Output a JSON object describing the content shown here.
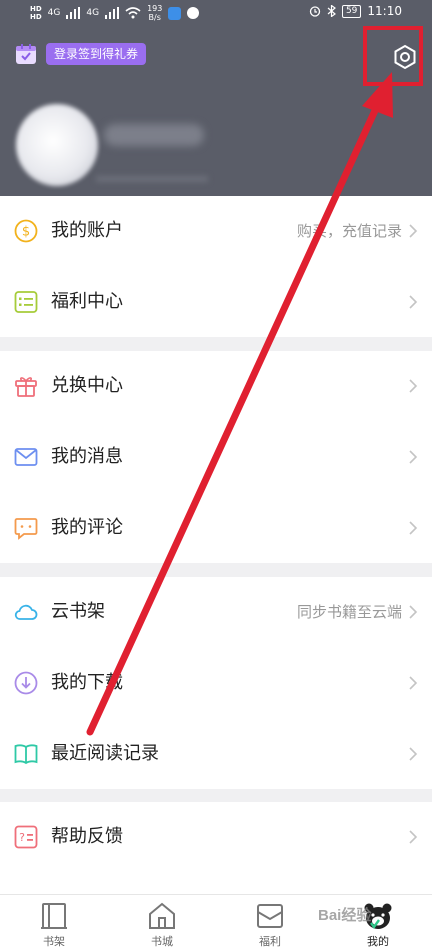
{
  "status_bar": {
    "hd_top": "HD",
    "hd_bottom": "HD",
    "signal1": "4G",
    "signal2": "4G",
    "speed": "193",
    "speed_unit": "B/s",
    "battery": "59",
    "time": "11:10"
  },
  "header": {
    "checkin_label": "登录签到得礼券"
  },
  "menu_groups": [
    {
      "items": [
        {
          "label": "我的账户",
          "extra": "购买，充值记录",
          "icon": "dollar-coin-icon"
        },
        {
          "label": "福利中心",
          "extra": "",
          "icon": "list-icon"
        }
      ]
    },
    {
      "items": [
        {
          "label": "兑换中心",
          "extra": "",
          "icon": "gift-icon"
        },
        {
          "label": "我的消息",
          "extra": "",
          "icon": "mail-icon"
        },
        {
          "label": "我的评论",
          "extra": "",
          "icon": "comment-icon"
        }
      ]
    },
    {
      "items": [
        {
          "label": "云书架",
          "extra": "同步书籍至云端",
          "icon": "cloud-icon"
        },
        {
          "label": "我的下载",
          "extra": "",
          "icon": "download-icon"
        },
        {
          "label": "最近阅读记录",
          "extra": "",
          "icon": "open-book-icon"
        }
      ]
    },
    {
      "items": [
        {
          "label": "帮助反馈",
          "extra": "",
          "icon": "help-feedback-icon"
        }
      ]
    }
  ],
  "tabbar": {
    "tabs": [
      {
        "label": "书架",
        "icon": "bookshelf-icon"
      },
      {
        "label": "书城",
        "icon": "bookstore-icon"
      },
      {
        "label": "福利",
        "icon": "welfare-envelope-icon"
      },
      {
        "label": "我的",
        "icon": "bear-profile-icon",
        "active": true
      }
    ]
  },
  "watermark": "Bai经验",
  "colors": {
    "header_bg": "#5a5d68",
    "checkin_pill": "#9a6ef0",
    "annotation_red": "#e02030",
    "page_bg": "#f0f0f2"
  }
}
